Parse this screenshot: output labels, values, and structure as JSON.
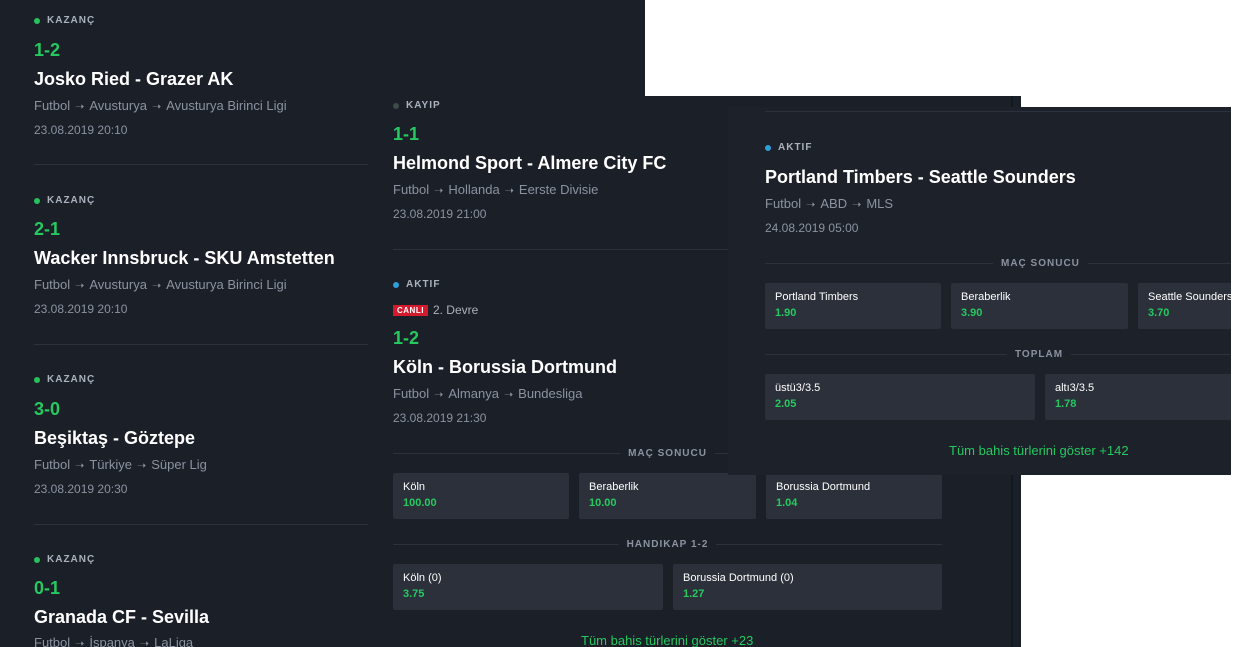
{
  "left_list": [
    {
      "status": "KAZANÇ",
      "score": "1-2",
      "title": "Josko Ried - Grazer AK",
      "sport": "Futbol",
      "country": "Avusturya",
      "league": "Avusturya Birinci Ligi",
      "date": "23.08.2019 20:10"
    },
    {
      "status": "KAZANÇ",
      "score": "2-1",
      "title": "Wacker Innsbruck - SKU Amstetten",
      "sport": "Futbol",
      "country": "Avusturya",
      "league": "Avusturya Birinci Ligi",
      "date": "23.08.2019 20:10"
    },
    {
      "status": "KAZANÇ",
      "score": "3-0",
      "title": "Beşiktaş - Göztepe",
      "sport": "Futbol",
      "country": "Türkiye",
      "league": "Süper Lig",
      "date": "23.08.2019 20:30"
    },
    {
      "status": "KAZANÇ",
      "score": "0-1",
      "title": "Granada CF - Sevilla",
      "sport": "Futbol",
      "country": "İspanya",
      "league": "LaLiga",
      "date": ""
    }
  ],
  "middle": {
    "match1": {
      "status": "KAYIP",
      "score": "1-1",
      "title": "Helmond Sport - Almere City FC",
      "sport": "Futbol",
      "country": "Hollanda",
      "league": "Eerste Divisie",
      "date": "23.08.2019 21:00"
    },
    "match2": {
      "status": "AKTIF",
      "live_badge": "CANLI",
      "period": "2. Devre",
      "score": "1-2",
      "title": "Köln - Borussia Dortmund",
      "sport": "Futbol",
      "country": "Almanya",
      "league": "Bundesliga",
      "date": "23.08.2019 21:30",
      "market1": {
        "title": "MAÇ SONUCU",
        "odds": [
          {
            "label": "Köln",
            "value": "100.00"
          },
          {
            "label": "Beraberlik",
            "value": "10.00"
          },
          {
            "label": "Borussia Dortmund",
            "value": "1.04"
          }
        ]
      },
      "market2": {
        "title": "HANDIKAP 1-2",
        "odds": [
          {
            "label": "Köln (0)",
            "value": "3.75"
          },
          {
            "label": "Borussia Dortmund (0)",
            "value": "1.27"
          }
        ]
      },
      "more": "Tüm bahis türlerini göster +23"
    }
  },
  "right": {
    "status": "AKTIF",
    "title": "Portland Timbers - Seattle Sounders",
    "sport": "Futbol",
    "country": "ABD",
    "league": "MLS",
    "date": "24.08.2019 05:00",
    "market1": {
      "title": "MAÇ SONUCU",
      "odds": [
        {
          "label": "Portland Timbers",
          "value": "1.90"
        },
        {
          "label": "Beraberlik",
          "value": "3.90"
        },
        {
          "label": "Seattle Sounders",
          "value": "3.70"
        }
      ]
    },
    "market2": {
      "title": "TOPLAM",
      "odds": [
        {
          "label": "üstü3/3.5",
          "value": "2.05"
        },
        {
          "label": "altı3/3.5",
          "value": "1.78"
        }
      ]
    },
    "more": "Tüm bahis türlerini göster +142"
  },
  "colors": {
    "win": "#26c960",
    "bg": "#1b1f28",
    "card": "#2b303a",
    "live": "#d61a2e",
    "active_dot": "#2f9fd8",
    "lost_dot": "#3d4a4a"
  },
  "icons": {
    "path_separator": "arrow-right-icon",
    "status_dot": "status-dot-icon"
  }
}
